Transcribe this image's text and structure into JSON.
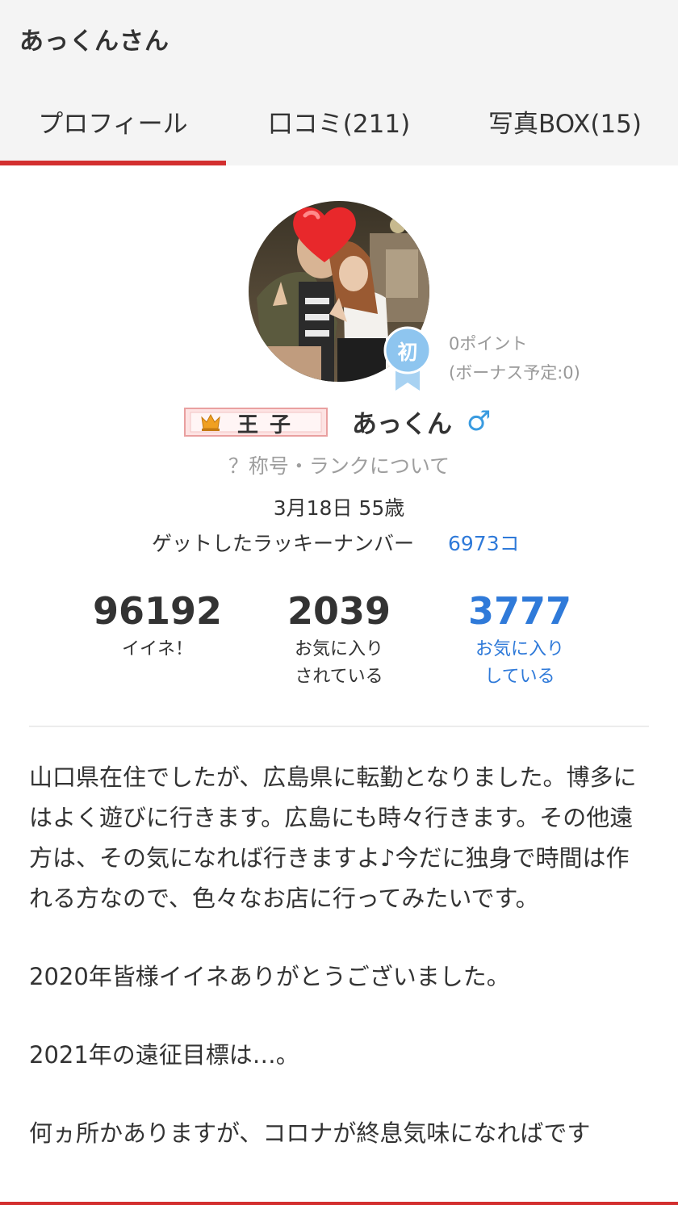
{
  "header": {
    "title": "あっくんさん"
  },
  "tabs": [
    {
      "label": "プロフィール",
      "active": true
    },
    {
      "label": "口コミ(211)",
      "active": false
    },
    {
      "label": "写真BOX(15)",
      "active": false
    }
  ],
  "profile": {
    "first_badge": "初",
    "points": "0ポイント",
    "bonus": "(ボーナス予定:0)",
    "rank_badge": "王子",
    "name": "あっくん",
    "gender_icon": "♂",
    "rank_link": "？称号・ランクについて",
    "birthday": "3月18日 55歳",
    "lucky_label": "ゲットしたラッキーナンバー",
    "lucky_value": "6973コ"
  },
  "stats": [
    {
      "value": "96192",
      "label_line1": "イイネ！",
      "label_line2": ""
    },
    {
      "value": "2039",
      "label_line1": "お気に入り",
      "label_line2": "されている"
    },
    {
      "value": "3777",
      "label_line1": "お気に入り",
      "label_line2": "している"
    }
  ],
  "bio": [
    "山口県在住でしたが、広島県に転勤となりました。博多にはよく遊びに行きます。広島にも時々行きます。その他遠方は、その気になれば行きますよ♪今だに独身で時間は作れる方なので、色々なお店に行ってみたいです。",
    "2020年皆様イイネありがとうございました。",
    "2021年の遠征目標は…。",
    "何ヵ所かありますが、コロナが終息気味になればです"
  ],
  "colors": {
    "accent": "#d32f2f",
    "link": "#2f7ad9",
    "gender": "#3a9be0",
    "badge": "#8ec5ef"
  }
}
